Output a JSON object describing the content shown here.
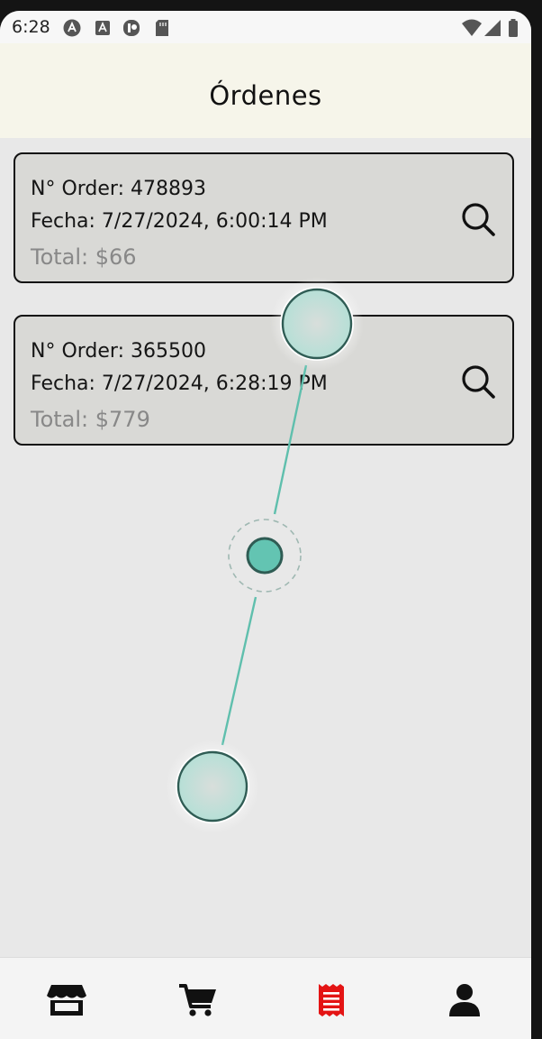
{
  "status_bar": {
    "time": "6:28",
    "icons_left": [
      "a-circle-icon",
      "a-box-icon",
      "shield-icon",
      "sd-card-icon"
    ],
    "icons_right": [
      "wifi-icon",
      "signal-icon",
      "battery-icon"
    ]
  },
  "header": {
    "title": "Órdenes"
  },
  "orders": [
    {
      "number": "N° Order: 478893",
      "date": "Fecha: 7/27/2024, 6:00:14 PM",
      "total": "Total: $66"
    },
    {
      "number": "N° Order: 365500",
      "date": "Fecha: 7/27/2024, 6:28:19 PM",
      "total": "Total: $779"
    }
  ],
  "bottom_nav": {
    "items": [
      "store-icon",
      "cart-icon",
      "receipt-icon",
      "user-icon"
    ],
    "active_index": 2,
    "active_color": "#e41414",
    "inactive_color": "#111111"
  },
  "colors": {
    "header_bg": "#f6f5ea",
    "content_bg": "#e8e8e8",
    "card_bg": "#d9d9d6",
    "gesture_accent": "#5fbfad"
  }
}
